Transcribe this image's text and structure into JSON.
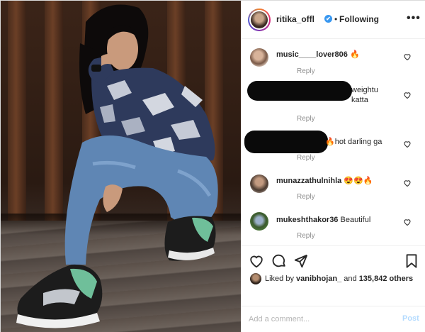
{
  "header": {
    "username": "ritika_offl",
    "verified_mark": "✔",
    "separator": "•",
    "follow_status": "Following",
    "more_label": "•••"
  },
  "comments": [
    {
      "username": "music____lover806",
      "text": " 🔥",
      "reply_label": "Reply",
      "avatar": "user-avatar-photo",
      "redacted": false
    },
    {
      "username": "",
      "text": "weightu katta",
      "reply_label": "Reply",
      "avatar": "redacted",
      "redacted": true
    },
    {
      "username": "",
      "text": "🔥hot darling ga",
      "reply_label": "Reply",
      "avatar": "redacted",
      "redacted": true
    },
    {
      "username": "munazzathulnihla",
      "text": " 😍😍🔥",
      "reply_label": "Reply",
      "avatar": "user-avatar-photo",
      "redacted": false
    },
    {
      "username": "mukeshthakor36",
      "text": " Beautiful",
      "reply_label": "Reply",
      "avatar": "user-avatar-photo",
      "redacted": false
    }
  ],
  "actions": {
    "icons": [
      "heart-icon",
      "comment-icon",
      "share-icon",
      "bookmark-icon"
    ]
  },
  "likes": {
    "prefix": "Liked by ",
    "first_user": "vanibhojan_",
    "middle": " and ",
    "count": "135,842 others"
  },
  "add_comment": {
    "placeholder": "Add a comment...",
    "post_label": "Post"
  },
  "colors": {
    "verified": "#3897f0",
    "post_button_disabled": "#b3dbff",
    "secondary_text": "#8e8e8e",
    "divider": "#efefef"
  }
}
